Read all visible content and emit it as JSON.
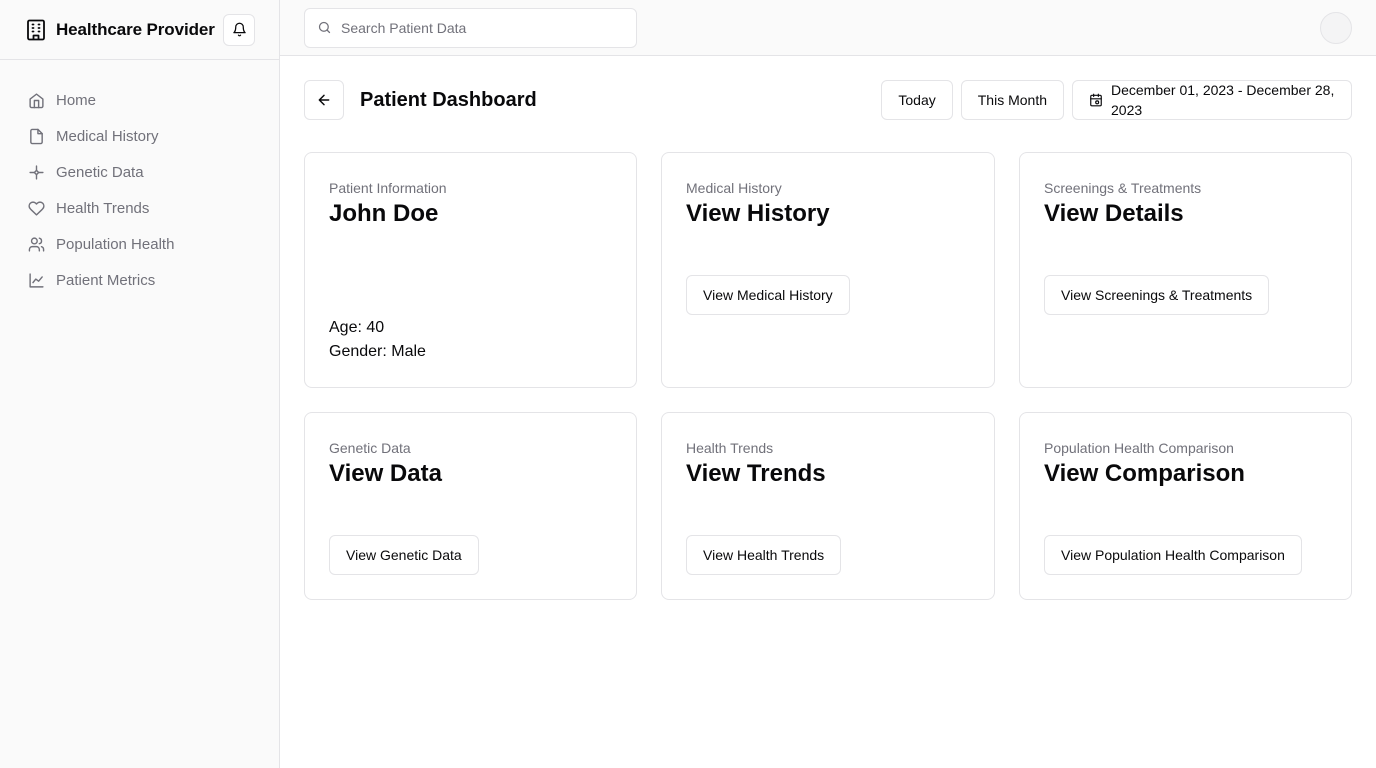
{
  "sidebar": {
    "brand": "Healthcare Provider",
    "brand_icon": "building-icon",
    "bell_icon": "bell-icon",
    "items": [
      {
        "label": "Home",
        "icon": "home-icon"
      },
      {
        "label": "Medical History",
        "icon": "file-icon"
      },
      {
        "label": "Genetic Data",
        "icon": "sparkle-icon"
      },
      {
        "label": "Health Trends",
        "icon": "heart-icon"
      },
      {
        "label": "Population Health",
        "icon": "users-icon"
      },
      {
        "label": "Patient Metrics",
        "icon": "line-chart-icon"
      }
    ]
  },
  "topbar": {
    "search_placeholder": "Search Patient Data",
    "search_value": ""
  },
  "header": {
    "title": "Patient Dashboard",
    "today_label": "Today",
    "month_label": "This Month",
    "date_range": "December 01, 2023 - December 28, 2023"
  },
  "cards": [
    {
      "label": "Patient Information",
      "value": "John Doe",
      "age": "Age: 40",
      "gender": "Gender: Male"
    },
    {
      "label": "Medical History",
      "value": "View History",
      "button": "View Medical History"
    },
    {
      "label": "Screenings & Treatments",
      "value": "View Details",
      "button": "View Screenings & Treatments"
    },
    {
      "label": "Genetic Data",
      "value": "View Data",
      "button": "View Genetic Data"
    },
    {
      "label": "Health Trends",
      "value": "View Trends",
      "button": "View Health Trends"
    },
    {
      "label": "Population Health Comparison",
      "value": "View Comparison",
      "button": "View Population Health Comparison"
    }
  ],
  "colors": {
    "text": "#09090b",
    "muted": "#71717a",
    "border": "#e4e4e7",
    "sidebar_bg": "#fafafa"
  }
}
